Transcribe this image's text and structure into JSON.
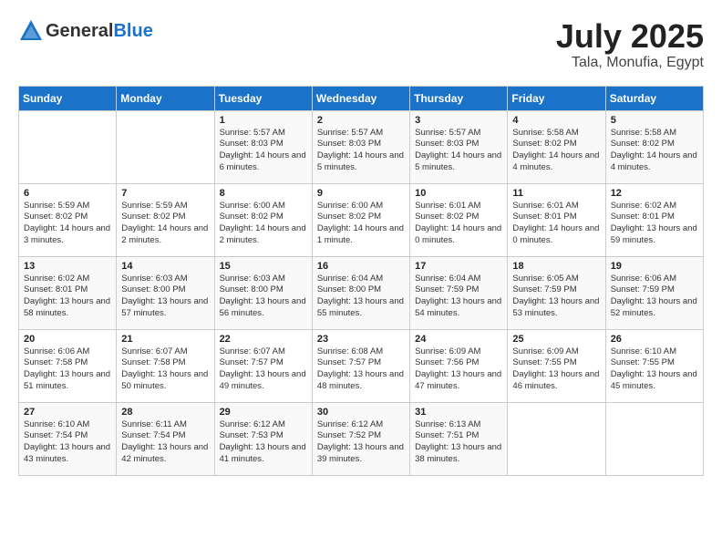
{
  "header": {
    "logo_general": "General",
    "logo_blue": "Blue",
    "title": "July 2025",
    "subtitle": "Tala, Monufia, Egypt"
  },
  "weekdays": [
    "Sunday",
    "Monday",
    "Tuesday",
    "Wednesday",
    "Thursday",
    "Friday",
    "Saturday"
  ],
  "weeks": [
    [
      {
        "day": "",
        "content": ""
      },
      {
        "day": "",
        "content": ""
      },
      {
        "day": "1",
        "content": "Sunrise: 5:57 AM\nSunset: 8:03 PM\nDaylight: 14 hours and 6 minutes."
      },
      {
        "day": "2",
        "content": "Sunrise: 5:57 AM\nSunset: 8:03 PM\nDaylight: 14 hours and 5 minutes."
      },
      {
        "day": "3",
        "content": "Sunrise: 5:57 AM\nSunset: 8:03 PM\nDaylight: 14 hours and 5 minutes."
      },
      {
        "day": "4",
        "content": "Sunrise: 5:58 AM\nSunset: 8:02 PM\nDaylight: 14 hours and 4 minutes."
      },
      {
        "day": "5",
        "content": "Sunrise: 5:58 AM\nSunset: 8:02 PM\nDaylight: 14 hours and 4 minutes."
      }
    ],
    [
      {
        "day": "6",
        "content": "Sunrise: 5:59 AM\nSunset: 8:02 PM\nDaylight: 14 hours and 3 minutes."
      },
      {
        "day": "7",
        "content": "Sunrise: 5:59 AM\nSunset: 8:02 PM\nDaylight: 14 hours and 2 minutes."
      },
      {
        "day": "8",
        "content": "Sunrise: 6:00 AM\nSunset: 8:02 PM\nDaylight: 14 hours and 2 minutes."
      },
      {
        "day": "9",
        "content": "Sunrise: 6:00 AM\nSunset: 8:02 PM\nDaylight: 14 hours and 1 minute."
      },
      {
        "day": "10",
        "content": "Sunrise: 6:01 AM\nSunset: 8:02 PM\nDaylight: 14 hours and 0 minutes."
      },
      {
        "day": "11",
        "content": "Sunrise: 6:01 AM\nSunset: 8:01 PM\nDaylight: 14 hours and 0 minutes."
      },
      {
        "day": "12",
        "content": "Sunrise: 6:02 AM\nSunset: 8:01 PM\nDaylight: 13 hours and 59 minutes."
      }
    ],
    [
      {
        "day": "13",
        "content": "Sunrise: 6:02 AM\nSunset: 8:01 PM\nDaylight: 13 hours and 58 minutes."
      },
      {
        "day": "14",
        "content": "Sunrise: 6:03 AM\nSunset: 8:00 PM\nDaylight: 13 hours and 57 minutes."
      },
      {
        "day": "15",
        "content": "Sunrise: 6:03 AM\nSunset: 8:00 PM\nDaylight: 13 hours and 56 minutes."
      },
      {
        "day": "16",
        "content": "Sunrise: 6:04 AM\nSunset: 8:00 PM\nDaylight: 13 hours and 55 minutes."
      },
      {
        "day": "17",
        "content": "Sunrise: 6:04 AM\nSunset: 7:59 PM\nDaylight: 13 hours and 54 minutes."
      },
      {
        "day": "18",
        "content": "Sunrise: 6:05 AM\nSunset: 7:59 PM\nDaylight: 13 hours and 53 minutes."
      },
      {
        "day": "19",
        "content": "Sunrise: 6:06 AM\nSunset: 7:59 PM\nDaylight: 13 hours and 52 minutes."
      }
    ],
    [
      {
        "day": "20",
        "content": "Sunrise: 6:06 AM\nSunset: 7:58 PM\nDaylight: 13 hours and 51 minutes."
      },
      {
        "day": "21",
        "content": "Sunrise: 6:07 AM\nSunset: 7:58 PM\nDaylight: 13 hours and 50 minutes."
      },
      {
        "day": "22",
        "content": "Sunrise: 6:07 AM\nSunset: 7:57 PM\nDaylight: 13 hours and 49 minutes."
      },
      {
        "day": "23",
        "content": "Sunrise: 6:08 AM\nSunset: 7:57 PM\nDaylight: 13 hours and 48 minutes."
      },
      {
        "day": "24",
        "content": "Sunrise: 6:09 AM\nSunset: 7:56 PM\nDaylight: 13 hours and 47 minutes."
      },
      {
        "day": "25",
        "content": "Sunrise: 6:09 AM\nSunset: 7:55 PM\nDaylight: 13 hours and 46 minutes."
      },
      {
        "day": "26",
        "content": "Sunrise: 6:10 AM\nSunset: 7:55 PM\nDaylight: 13 hours and 45 minutes."
      }
    ],
    [
      {
        "day": "27",
        "content": "Sunrise: 6:10 AM\nSunset: 7:54 PM\nDaylight: 13 hours and 43 minutes."
      },
      {
        "day": "28",
        "content": "Sunrise: 6:11 AM\nSunset: 7:54 PM\nDaylight: 13 hours and 42 minutes."
      },
      {
        "day": "29",
        "content": "Sunrise: 6:12 AM\nSunset: 7:53 PM\nDaylight: 13 hours and 41 minutes."
      },
      {
        "day": "30",
        "content": "Sunrise: 6:12 AM\nSunset: 7:52 PM\nDaylight: 13 hours and 39 minutes."
      },
      {
        "day": "31",
        "content": "Sunrise: 6:13 AM\nSunset: 7:51 PM\nDaylight: 13 hours and 38 minutes."
      },
      {
        "day": "",
        "content": ""
      },
      {
        "day": "",
        "content": ""
      }
    ]
  ]
}
